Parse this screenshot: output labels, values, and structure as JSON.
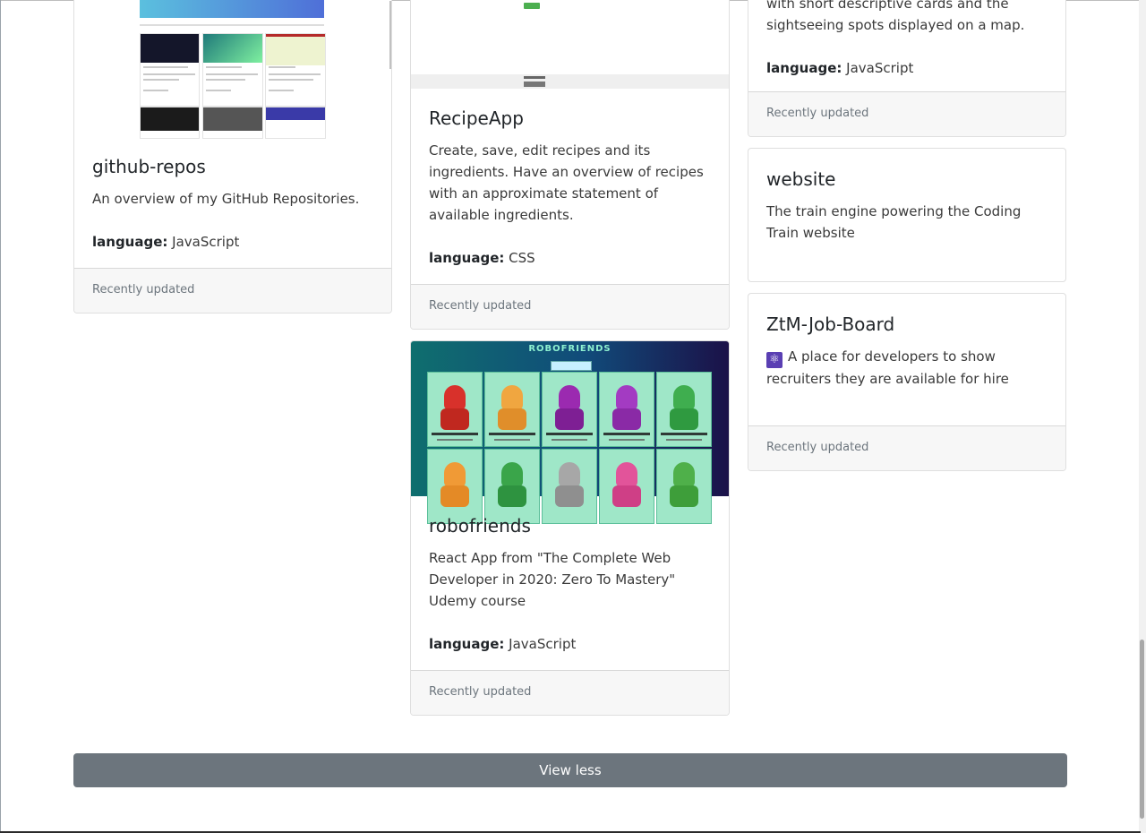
{
  "cards": {
    "github_repos": {
      "title": "github-repos",
      "description": "An overview of my GitHub Repositories.",
      "language_label": "language:",
      "language": "JavaScript",
      "footer": "Recently updated"
    },
    "recipe_app": {
      "title": "RecipeApp",
      "description": "Create, save, edit recipes and its ingredients. Have an overview of recipes with an approximate statement of available ingredients.",
      "language_label": "language:",
      "language": "CSS",
      "footer": "Recently updated"
    },
    "map_card": {
      "description_fragment": "with short descriptive cards and the sightseeing spots displayed on a map.",
      "language_label": "language:",
      "language": "JavaScript",
      "footer": "Recently updated"
    },
    "website": {
      "title": "website",
      "description": "The train engine powering the Coding Train website"
    },
    "ztm_job_board": {
      "title": "ZtM-Job-Board",
      "icon": "react-icon",
      "description": "A place for developers to show recruiters they are available for hire",
      "footer": "Recently updated"
    },
    "robofriends": {
      "title": "robofriends",
      "preview_heading": "ROBOFRIENDS",
      "description": "React App from \"The Complete Web Developer in 2020: Zero To Mastery\" Udemy course",
      "language_label": "language:",
      "language": "JavaScript",
      "footer": "Recently updated"
    }
  },
  "view_less_label": "View less",
  "colors": {
    "button": "#6c757d",
    "footer_bg": "#f7f7f7",
    "robo_bg": "#9fe7c8"
  }
}
